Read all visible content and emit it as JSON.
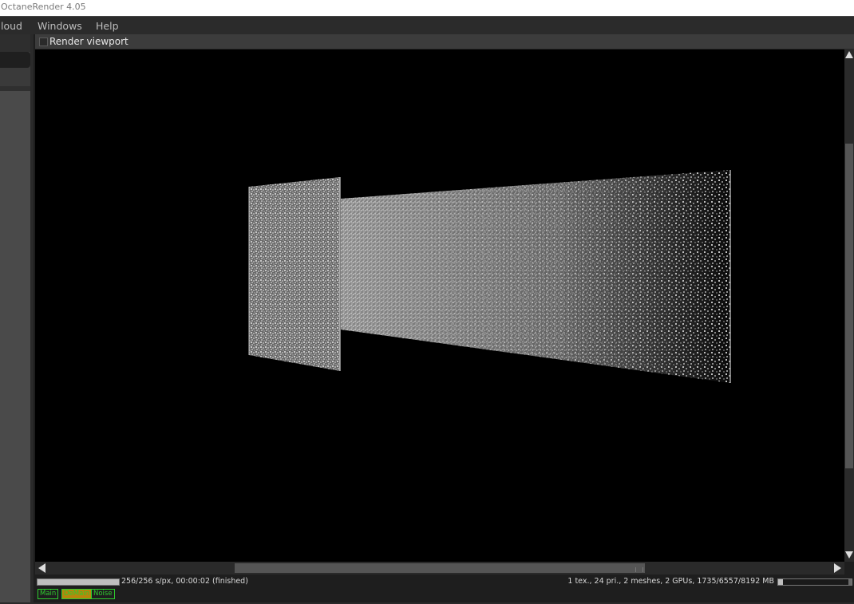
{
  "window": {
    "title": "OctaneRender 4.05"
  },
  "menubar": {
    "items": [
      "loud",
      "Windows",
      "Help"
    ]
  },
  "viewport": {
    "title": "Render viewport",
    "enabled": false
  },
  "render_scene": {
    "description_icon": "point-cloud-render"
  },
  "statusbar": {
    "progress": 1.0,
    "status_text": "256/256 s/px, 00:00:02 (finished)",
    "stats_text": "1 tex., 24 pri., 2 meshes, 2 GPUs, 1735/6557/8192 MB",
    "memory": {
      "used": 1735,
      "reserved": 6557,
      "total": 8192
    }
  },
  "passes": [
    {
      "label": "Main",
      "active": false
    },
    {
      "label": "DeMain",
      "active": true
    },
    {
      "label": "Noise",
      "active": false
    }
  ],
  "colors": {
    "pass_accent": "#2ecc2e",
    "pass_active_bg": "#b8860b"
  }
}
